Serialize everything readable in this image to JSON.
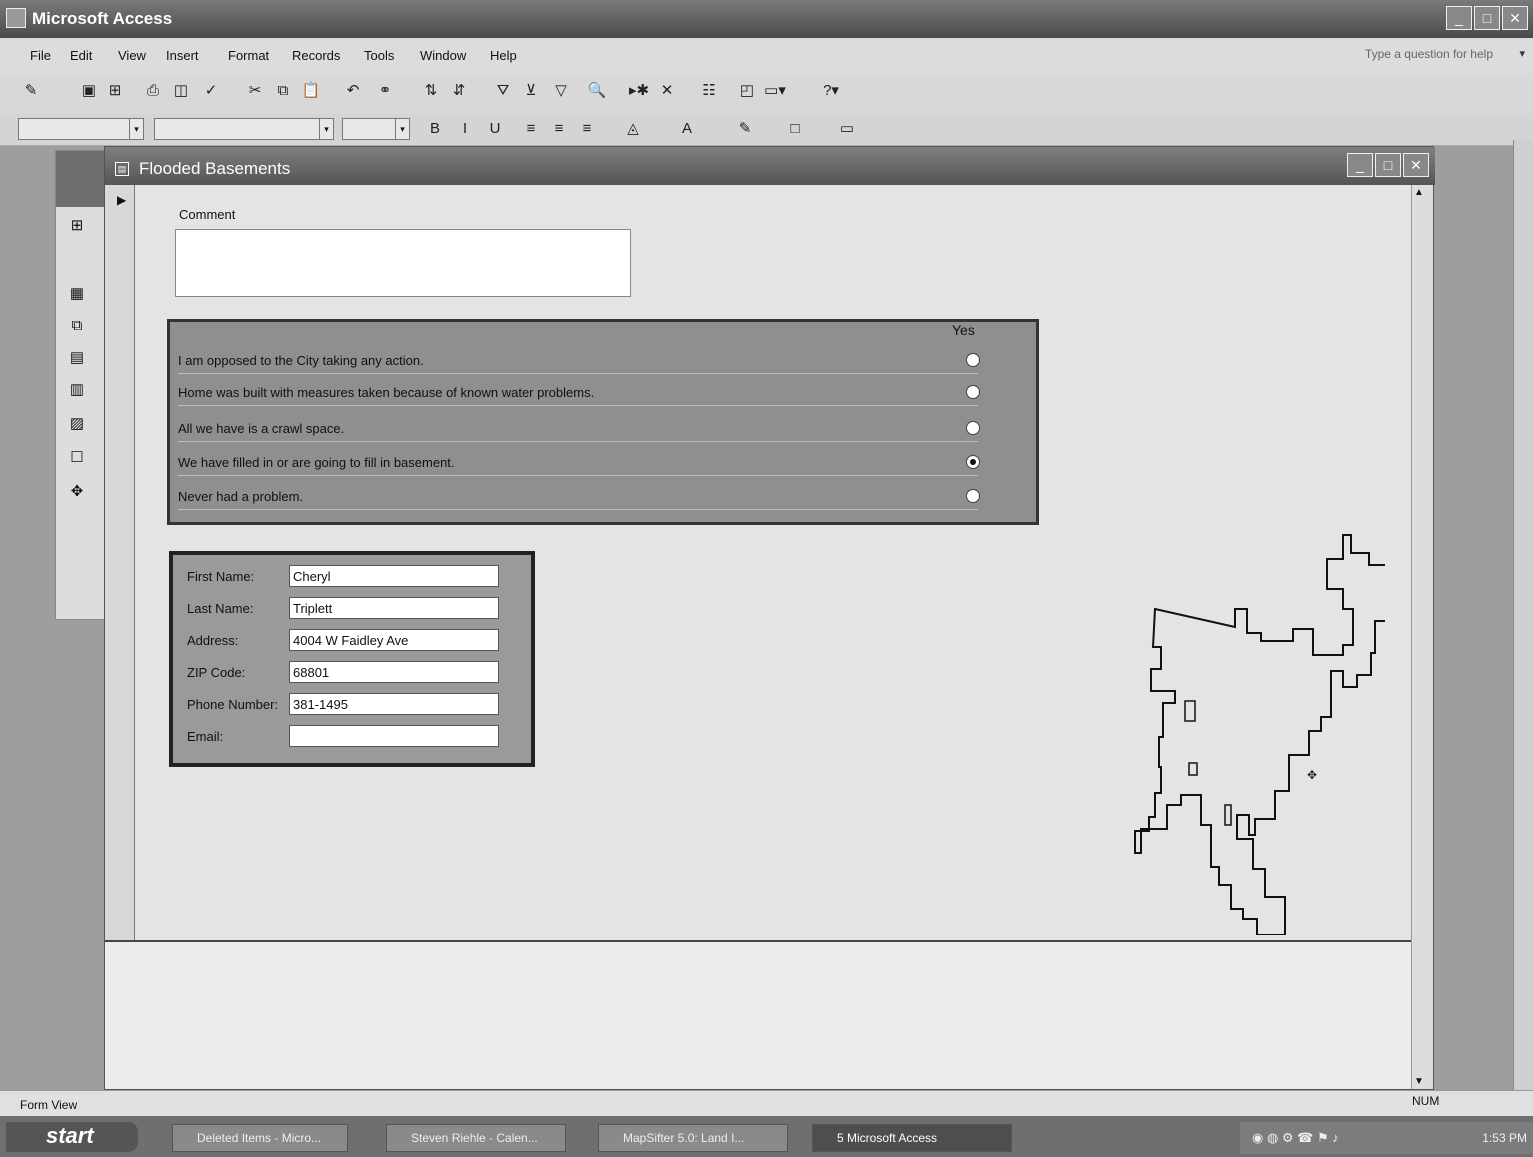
{
  "app": {
    "title": "Microsoft Access",
    "window_controls": [
      "_",
      "□",
      "✕"
    ]
  },
  "menu": {
    "items": [
      "File",
      "Edit",
      "View",
      "Insert",
      "Format",
      "Records",
      "Tools",
      "Window",
      "Help"
    ],
    "ask_placeholder": "Type a question for help"
  },
  "toolbar": {
    "icons": [
      "view-icon",
      "save-icon",
      "search-db-icon",
      "print-icon",
      "print-preview-icon",
      "spelling-icon",
      "cut-icon",
      "copy-icon",
      "paste-icon",
      "undo-icon",
      "insert-hyperlink-icon",
      "sort-ascending-icon",
      "sort-descending-icon",
      "filter-by-selection-icon",
      "filter-by-form-icon",
      "apply-filter-icon",
      "find-icon",
      "new-record-icon",
      "delete-record-icon",
      "properties-icon",
      "database-window-icon",
      "new-object-icon",
      "help-icon"
    ]
  },
  "form": {
    "title": "Flooded Basements",
    "comment_label": "Comment",
    "yes_header": "Yes",
    "options": [
      {
        "label": "I am opposed to the City taking any action.",
        "checked": false
      },
      {
        "label": "Home was built with measures taken because of known water problems.",
        "checked": false
      },
      {
        "label": "All we have is a crawl space.",
        "checked": false
      },
      {
        "label": "We have filled in or are going to fill in basement.",
        "checked": true
      },
      {
        "label": "Never had a problem.",
        "checked": false
      }
    ],
    "fields": [
      {
        "label": "First Name:",
        "value": "Cheryl"
      },
      {
        "label": "Last Name:",
        "value": "Triplett"
      },
      {
        "label": "Address:",
        "value": "4004 W Faidley Ave"
      },
      {
        "label": "ZIP Code:",
        "value": "68801"
      },
      {
        "label": "Phone Number:",
        "value": "381-1495"
      },
      {
        "label": "Email:",
        "value": ""
      }
    ]
  },
  "status": {
    "text": "Form View",
    "num": "NUM"
  },
  "taskbar": {
    "start": "start",
    "tasks": [
      {
        "label": "Deleted Items - Micro...",
        "active": false
      },
      {
        "label": "Steven Riehle - Calen...",
        "active": false
      },
      {
        "label": "MapSifter 5.0: Land I...",
        "active": false
      },
      {
        "label": "5 Microsoft Access",
        "active": true
      }
    ],
    "clock": "1:53 PM"
  }
}
